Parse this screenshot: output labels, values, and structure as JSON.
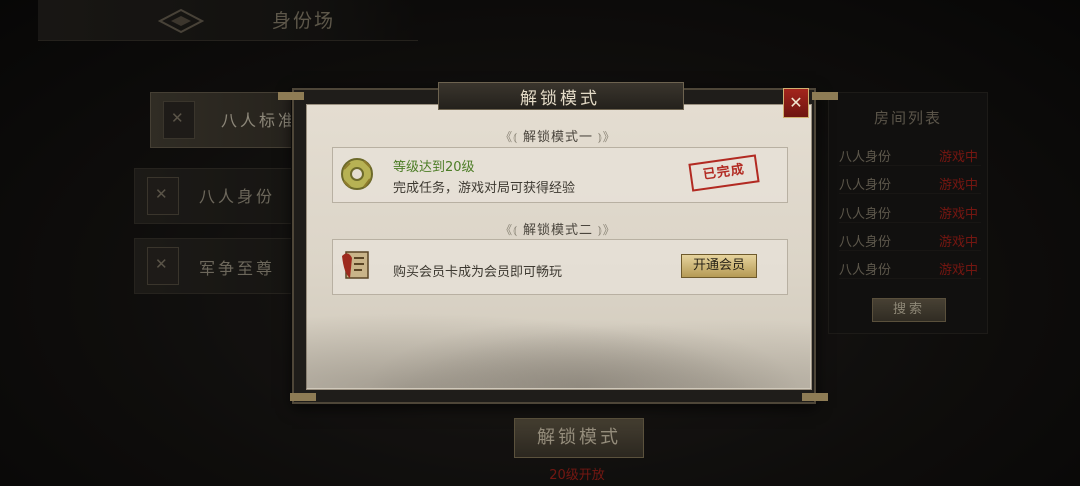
{
  "header": {
    "title": "身份场",
    "logo_icon": "diamond-emblem-icon"
  },
  "modes": [
    {
      "label": "八人标准",
      "active": true
    },
    {
      "label": "八人身份",
      "active": false
    },
    {
      "label": "军争至尊",
      "active": false
    }
  ],
  "room_list": {
    "title": "房间列表",
    "rows": [
      {
        "name": "八人身份",
        "state": "游戏中"
      },
      {
        "name": "八人身份",
        "state": "游戏中"
      },
      {
        "name": "八人身份",
        "state": "游戏中"
      },
      {
        "name": "八人身份",
        "state": "游戏中"
      },
      {
        "name": "八人身份",
        "state": "游戏中"
      }
    ],
    "search_label": "搜索"
  },
  "bottom": {
    "unlock_button": "解锁模式",
    "note": "20级开放"
  },
  "modal": {
    "title": "解锁模式",
    "close_icon": "close-icon",
    "section1": {
      "heading": "解锁模式一",
      "requirement": "等级达到20级",
      "description": "完成任务，游戏对局可获得经验",
      "stamp": "已完成"
    },
    "section2": {
      "heading": "解锁模式二",
      "description": "购买会员卡成为会员即可畅玩",
      "button": "开通会员"
    }
  },
  "colors": {
    "accent_red": "#b3231b",
    "accent_green": "#4c7d26",
    "gold": "#b59a55"
  }
}
